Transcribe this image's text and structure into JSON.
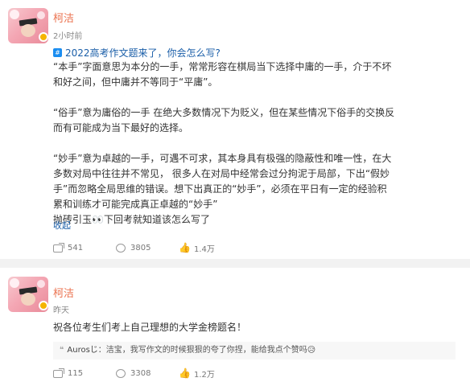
{
  "post1": {
    "username": "柯洁",
    "time": "2小时前",
    "topic": "2022高考作文题来了，你会怎么写?",
    "paragraphs": [
      "“本手”字面意思为本分的一手，常常形容在棋局当下选择中庸的一手，介于不坏和好之间，但中庸并不等同于“平庸”。",
      "“俗手”意为庸俗的一手 在绝大多数情况下为贬义，但在某些情况下俗手的交换反而有可能成为当下最好的选择。",
      "“妙手”意为卓越的一手，可遇不可求，其本身具有极强的隐蔽性和唯一性，在大多数对局中往往并不常见， 很多人在对局中经常会过分拘泥于局部，下出“假妙手”而忽略全局思维的错误。想下出真正的“妙手”，必须在平日有一定的经验积累和训练才可能完成真正卓越的“妙手”",
      "抛砖引玉👀下回考就知道该怎么写了"
    ],
    "collapse": "收起",
    "actions": {
      "shares": "541",
      "comments": "3805",
      "likes": "1.4万"
    }
  },
  "post2": {
    "username": "柯洁",
    "time": "昨天",
    "text": "祝各位考生们考上自己理想的大学金榜题名！",
    "quote": {
      "author": "Aurosじ",
      "text": "：洁宝，我写作文的时候狠狠的夸了你捏，能给我点个赞吗😥"
    },
    "actions": {
      "shares": "115",
      "comments": "3308",
      "likes": "1.2万"
    }
  },
  "colors": {
    "username": "#eb7350",
    "link": "#1a5ea8",
    "topic_icon": "#1a8df0"
  },
  "icons": [
    "share-icon",
    "comment-icon",
    "like-icon",
    "topic-icon",
    "quote-icon",
    "verified-badge"
  ]
}
